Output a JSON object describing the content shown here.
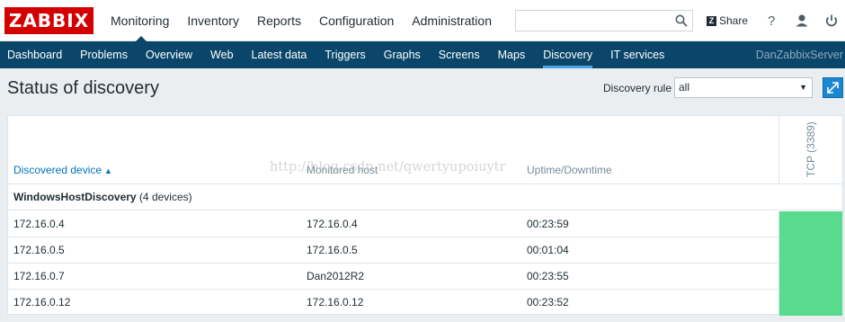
{
  "header": {
    "logo": "ZABBIX",
    "nav": [
      "Monitoring",
      "Inventory",
      "Reports",
      "Configuration",
      "Administration"
    ],
    "share_badge": "Z",
    "share": "Share",
    "search_value": ""
  },
  "subnav": {
    "items": [
      "Dashboard",
      "Problems",
      "Overview",
      "Web",
      "Latest data",
      "Triggers",
      "Graphs",
      "Screens",
      "Maps",
      "Discovery",
      "IT services"
    ],
    "active": "Discovery",
    "server": "DanZabbixServer"
  },
  "page": {
    "title": "Status of discovery",
    "filter_label": "Discovery rule",
    "filter_value": "all"
  },
  "table": {
    "columns": [
      "Discovered device",
      "Monitored host",
      "Uptime/Downtime"
    ],
    "service_column": "TCP (3389)",
    "sort_indicator": "▲",
    "group_name": "WindowsHostDiscovery",
    "group_count": "(4 devices)",
    "rows": [
      {
        "device": "172.16.0.4",
        "host": "172.16.0.4",
        "uptime": "00:23:59",
        "status": "up"
      },
      {
        "device": "172.16.0.5",
        "host": "172.16.0.5",
        "uptime": "00:01:04",
        "status": "up"
      },
      {
        "device": "172.16.0.7",
        "host": "Dan2012R2",
        "uptime": "00:23:55",
        "status": "up"
      },
      {
        "device": "172.16.0.12",
        "host": "172.16.0.12",
        "uptime": "00:23:52",
        "status": "up"
      }
    ]
  },
  "watermark": "http://blog.csdn.net/qwertyupoiuytr",
  "icons": [
    "search-icon",
    "share-icon",
    "help-icon",
    "user-icon",
    "power-icon",
    "fullscreen-icon"
  ],
  "colors": {
    "brand": "#d40000",
    "nav_bg": "#0a466a",
    "active_underline": "#4aa4e8",
    "status_up": "#59db8f",
    "link": "#0275b8",
    "button": "#1c87d1"
  }
}
